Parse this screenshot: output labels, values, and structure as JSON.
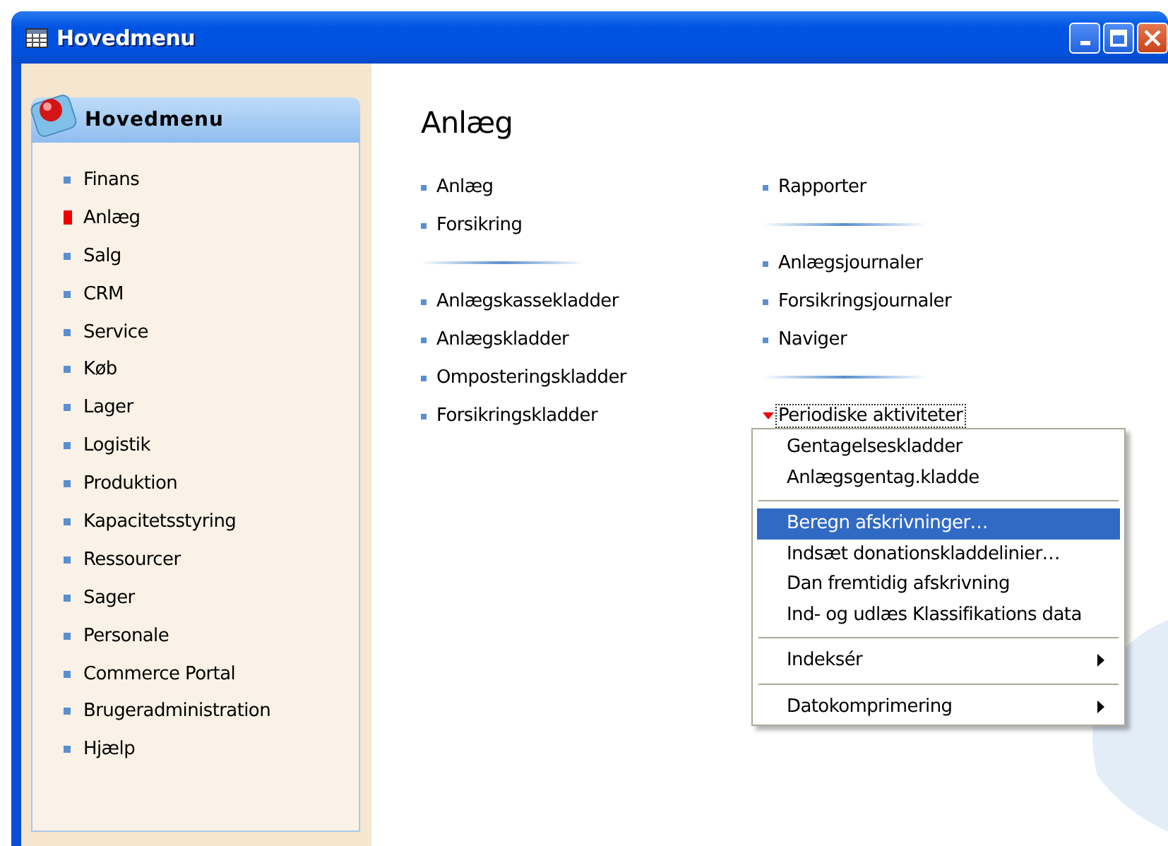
{
  "window": {
    "title": "Hovedmenu"
  },
  "sidebar": {
    "title": "Hovedmenu",
    "items": [
      {
        "label": "Finans",
        "selected": false
      },
      {
        "label": "Anlæg",
        "selected": true
      },
      {
        "label": "Salg",
        "selected": false
      },
      {
        "label": "CRM",
        "selected": false
      },
      {
        "label": "Service",
        "selected": false
      },
      {
        "label": "Køb",
        "selected": false
      },
      {
        "label": "Lager",
        "selected": false
      },
      {
        "label": "Logistik",
        "selected": false
      },
      {
        "label": "Produktion",
        "selected": false
      },
      {
        "label": "Kapacitetsstyring",
        "selected": false
      },
      {
        "label": "Ressourcer",
        "selected": false
      },
      {
        "label": "Sager",
        "selected": false
      },
      {
        "label": "Personale",
        "selected": false
      },
      {
        "label": "Commerce Portal",
        "selected": false
      },
      {
        "label": "Brugeradministration",
        "selected": false
      },
      {
        "label": "Hjælp",
        "selected": false
      }
    ]
  },
  "content": {
    "title": "Anlæg",
    "columns": [
      {
        "groups": [
          {
            "items": [
              {
                "label": "Anlæg",
                "kind": "link"
              },
              {
                "label": "Forsikring",
                "kind": "link"
              }
            ]
          },
          {
            "items": [
              {
                "label": "Anlægskassekladder",
                "kind": "link"
              },
              {
                "label": "Anlægskladder",
                "kind": "link"
              },
              {
                "label": "Omposteringskladder",
                "kind": "link"
              },
              {
                "label": "Forsikringskladder",
                "kind": "link"
              }
            ]
          }
        ]
      },
      {
        "groups": [
          {
            "items": [
              {
                "label": "Rapporter",
                "kind": "link"
              }
            ]
          },
          {
            "items": [
              {
                "label": "Anlægsjournaler",
                "kind": "link"
              },
              {
                "label": "Forsikringsjournaler",
                "kind": "link"
              },
              {
                "label": "Naviger",
                "kind": "link"
              }
            ]
          },
          {
            "items": [
              {
                "label": "Periodiske aktiviteter",
                "kind": "menu",
                "expanded": true,
                "focused": true
              }
            ]
          }
        ]
      }
    ]
  },
  "popup_menu": {
    "items": [
      {
        "kind": "item",
        "label": "Gentagelseskladder",
        "selected": false
      },
      {
        "kind": "item",
        "label": "Anlægsgentag.kladde",
        "selected": false
      },
      {
        "kind": "separator"
      },
      {
        "kind": "item",
        "label": "Beregn afskrivninger…",
        "selected": true
      },
      {
        "kind": "item",
        "label": "Indsæt donationskladdelinier…",
        "selected": false
      },
      {
        "kind": "item",
        "label": "Dan fremtidig afskrivning",
        "selected": false
      },
      {
        "kind": "item",
        "label": "Ind- og udlæs Klassifikations data",
        "selected": false
      },
      {
        "kind": "separator"
      },
      {
        "kind": "submenu",
        "label": "Indeksér",
        "selected": false
      },
      {
        "kind": "separator"
      },
      {
        "kind": "submenu",
        "label": "Datokomprimering",
        "selected": false
      }
    ]
  }
}
